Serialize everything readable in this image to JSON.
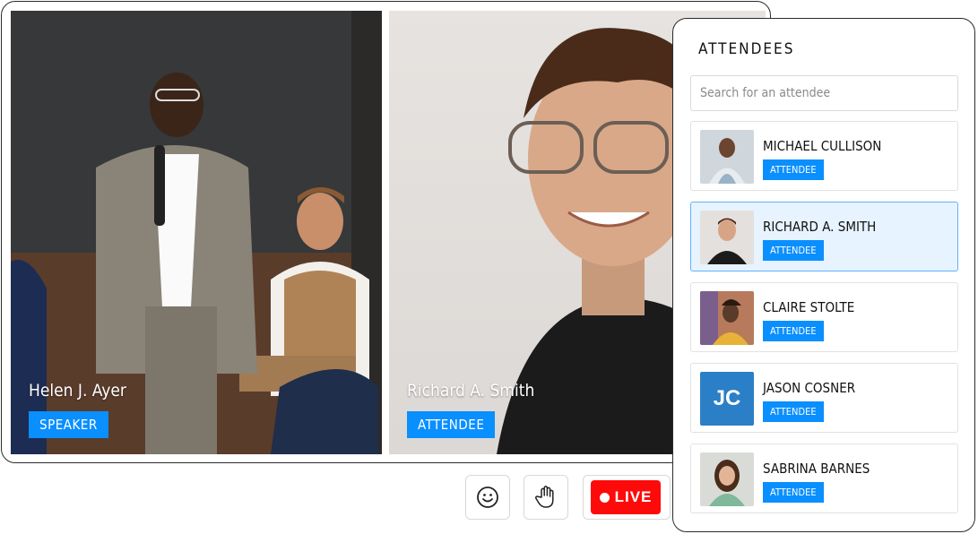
{
  "stage": {
    "tiles": [
      {
        "name": "Helen J. Ayer",
        "role": "SPEAKER"
      },
      {
        "name": "Richard A. Smith",
        "role": "ATTENDEE"
      }
    ]
  },
  "controls": {
    "emoji_icon": "smile-icon",
    "raise_hand_icon": "hand-icon",
    "live_label": "LIVE"
  },
  "attendees_panel": {
    "title": "ATTENDEES",
    "search_placeholder": "Search for an attendee",
    "items": [
      {
        "name": "MICHAEL CULLISON",
        "badge": "ATTENDEE",
        "avatar": "photo"
      },
      {
        "name": "RICHARD A. SMITH",
        "badge": "ATTENDEE",
        "avatar": "photo",
        "selected": true
      },
      {
        "name": "CLAIRE STOLTE",
        "badge": "ATTENDEE",
        "avatar": "photo"
      },
      {
        "name": "JASON COSNER",
        "badge": "ATTENDEE",
        "avatar_initials": "JC"
      },
      {
        "name": "SABRINA BARNES",
        "badge": "ATTENDEE",
        "avatar": "photo"
      }
    ]
  },
  "colors": {
    "badge_blue": "#0a8fff",
    "live_red": "#ff0a0a",
    "selected_bg": "#e7f3ff",
    "initials_bg": "#2b7fc6"
  }
}
